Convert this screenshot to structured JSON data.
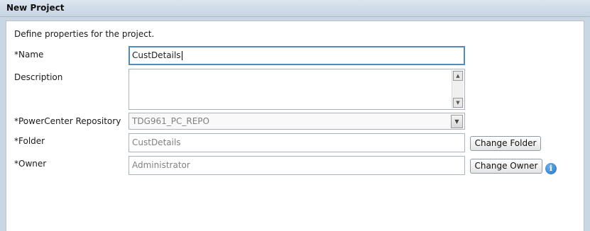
{
  "window": {
    "title": "New Project"
  },
  "form": {
    "intro": "Define properties for the project.",
    "name": {
      "label": "*Name",
      "value": "CustDetails"
    },
    "description": {
      "label": "Description",
      "value": ""
    },
    "repository": {
      "label": "*PowerCenter Repository",
      "value": "TDG961_PC_REPO"
    },
    "folder": {
      "label": "*Folder",
      "value": "CustDetails",
      "button": "Change Folder"
    },
    "owner": {
      "label": "*Owner",
      "value": "Administrator",
      "button": "Change Owner"
    }
  },
  "icons": {
    "info": "info-icon",
    "scroll_up": "scroll-up-arrow-icon",
    "scroll_down": "scroll-down-arrow-icon",
    "dropdown": "chevron-down-icon"
  },
  "colors": {
    "title_bar": "#c7d4e2",
    "focus_border": "#4f8bbf",
    "info_icon": "#1e6fc0"
  }
}
